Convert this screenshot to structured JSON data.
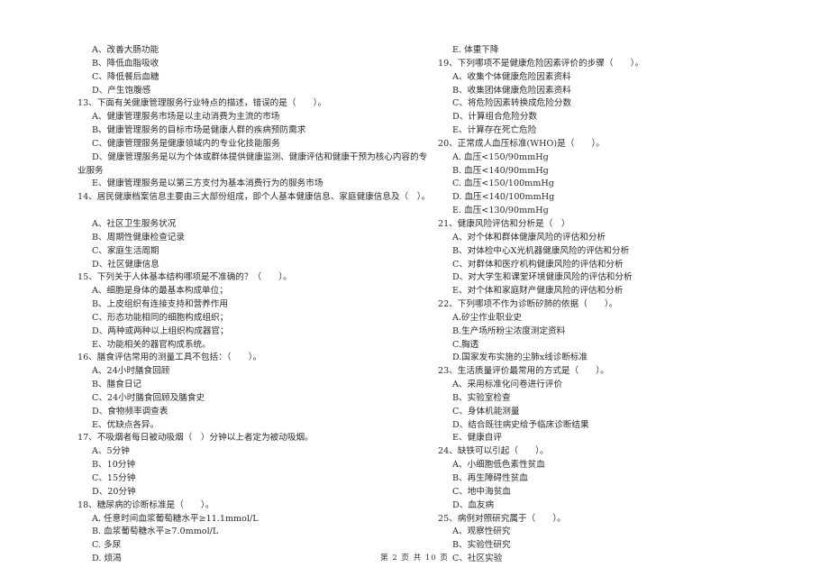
{
  "left_column": [
    {
      "type": "opt",
      "text": "A、改善大肠功能"
    },
    {
      "type": "opt",
      "text": "B、降低血脂吸收"
    },
    {
      "type": "opt",
      "text": "C、降低餐后血糖"
    },
    {
      "type": "opt",
      "text": "D、产生饱腹感"
    },
    {
      "type": "q",
      "text": "13、下面有关健康管理服务行业特点的描述，错误的是（　　）。"
    },
    {
      "type": "opt",
      "text": "A、健康管理服务市场是以主动消费为主流的市场"
    },
    {
      "type": "opt",
      "text": "B、健康管理服务的目标市场是健康人群的疾病预防需求"
    },
    {
      "type": "opt",
      "text": "C、健康管理服务是健康领域内的专业化技能服务"
    },
    {
      "type": "opt",
      "text": "D、健康管理服务是以为个体或群体提供健康监测、健康评估和健康干预为核心内容的专"
    },
    {
      "type": "cont",
      "text": "业服务"
    },
    {
      "type": "opt",
      "text": "E、健康管理服务是以第三方支付为基本消费行为的服务市场"
    },
    {
      "type": "q",
      "text": "14、居民健康档案信息主要由三大部份组成，即个人基本健康信息、家庭健康信息及（　）。"
    },
    {
      "type": "blank",
      "text": ""
    },
    {
      "type": "opt",
      "text": "A、社区卫生服务状况"
    },
    {
      "type": "opt",
      "text": "B、周期性健康检查记录"
    },
    {
      "type": "opt",
      "text": "C、家庭生活周期"
    },
    {
      "type": "opt",
      "text": "D、社区健康信息"
    },
    {
      "type": "q",
      "text": "15、下列关于人体基本结构哪项是不准确的？（　　）。"
    },
    {
      "type": "opt",
      "text": "A、细胞是身体的最基本构成单位；"
    },
    {
      "type": "opt",
      "text": "B、上皮组织有连接支持和营养作用"
    },
    {
      "type": "opt",
      "text": "C、形态功能相同的细胞构成组织；"
    },
    {
      "type": "opt",
      "text": "D、两种或两种以上组织构成器官；"
    },
    {
      "type": "opt",
      "text": "E、功能相关的器官构成系统。"
    },
    {
      "type": "q",
      "text": "16、膳食评估常用的测量工具不包括：（　　）。"
    },
    {
      "type": "opt",
      "text": "A、24小时膳食回顾"
    },
    {
      "type": "opt",
      "text": "B、膳食日记"
    },
    {
      "type": "opt",
      "text": "C、24小时膳食回顾及膳食史"
    },
    {
      "type": "opt",
      "text": "D、食物频率调查表"
    },
    {
      "type": "opt",
      "text": "E、优缺点各异。"
    },
    {
      "type": "q",
      "text": "17、不吸烟者每日被动吸烟（　）分钟以上者定为被动吸烟。"
    },
    {
      "type": "opt",
      "text": "A、5分钟"
    },
    {
      "type": "opt",
      "text": "B、10分钟"
    },
    {
      "type": "opt",
      "text": "C、15分钟"
    },
    {
      "type": "opt",
      "text": "D、20分钟"
    },
    {
      "type": "q",
      "text": "18、糖尿病的诊断标准是（　　）。"
    },
    {
      "type": "opt",
      "text": "A. 任意时间血浆葡萄糖水平≥11.1mmol/L"
    },
    {
      "type": "opt",
      "text": "B. 血浆葡萄糖水平≥7.0mmol/L"
    },
    {
      "type": "opt",
      "text": "C. 多尿"
    },
    {
      "type": "opt",
      "text": "D. 烦渴"
    }
  ],
  "right_column": [
    {
      "type": "opt",
      "text": "E. 体重下降"
    },
    {
      "type": "q",
      "text": "19、下列哪项不是健康危险因素评价的步骤（　　）。"
    },
    {
      "type": "opt",
      "text": "A、收集个体健康危险因素资料"
    },
    {
      "type": "opt",
      "text": "B、收集团体健康危险因素资料"
    },
    {
      "type": "opt",
      "text": "C、将危险因素转换成危险分数"
    },
    {
      "type": "opt",
      "text": "D、计算组合危险分数"
    },
    {
      "type": "opt",
      "text": "E、计算存在死亡危险"
    },
    {
      "type": "q",
      "text": "20、正常成人血压标准(WHO)是（　　）。"
    },
    {
      "type": "opt",
      "text": "A. 血压<150/90mmHg"
    },
    {
      "type": "opt",
      "text": "B. 血压<140/90mmHg"
    },
    {
      "type": "opt",
      "text": "C. 血压<150/100mmHg"
    },
    {
      "type": "opt",
      "text": "D. 血压<140/100mmHg"
    },
    {
      "type": "opt",
      "text": "E. 血压<130/90mmHg"
    },
    {
      "type": "q",
      "text": "21、健康风险评估和分析是（　）"
    },
    {
      "type": "opt",
      "text": "A、对个体和群体健康风险的评估和分析"
    },
    {
      "type": "opt",
      "text": "B、对体检中心X光机器健康风险的评估和分析"
    },
    {
      "type": "opt",
      "text": "C、对群体和医疗机构健康风险的评估和分析"
    },
    {
      "type": "opt",
      "text": "D、对大学生和课堂环境健康风险的评估和分析"
    },
    {
      "type": "opt",
      "text": "E、对个体和家庭财产健康风险的评估和分析"
    },
    {
      "type": "q",
      "text": "22、下列哪项不作为诊断矽肺的依据（　　）。"
    },
    {
      "type": "opt",
      "text": "A.矽尘作业职业史"
    },
    {
      "type": "opt",
      "text": "B.生产场所粉尘浓度测定资料"
    },
    {
      "type": "opt",
      "text": "C.胸透"
    },
    {
      "type": "opt",
      "text": "D.国家发布实施的尘肺x线诊断标准"
    },
    {
      "type": "q",
      "text": "23、生活质量评价最常用的方式是（　　）。"
    },
    {
      "type": "opt",
      "text": "A、采用标准化问卷进行评价"
    },
    {
      "type": "opt",
      "text": "B、实验室检查"
    },
    {
      "type": "opt",
      "text": "C、身体机能测量"
    },
    {
      "type": "opt",
      "text": "D、结合既往病史给予临床诊断结果"
    },
    {
      "type": "opt",
      "text": "E、健康自评"
    },
    {
      "type": "q",
      "text": "24、缺铁可以引起（　　）。"
    },
    {
      "type": "opt",
      "text": "A、小细胞低色素性贫血"
    },
    {
      "type": "opt",
      "text": "B、再生障碍性贫血"
    },
    {
      "type": "opt",
      "text": "C、地中海贫血"
    },
    {
      "type": "opt",
      "text": "D、血友病"
    },
    {
      "type": "q",
      "text": "25、病例对照研究属于（　　）。"
    },
    {
      "type": "opt",
      "text": "A、观察性研究"
    },
    {
      "type": "opt",
      "text": "B、实验性研究"
    },
    {
      "type": "opt",
      "text": "C、社区实验"
    }
  ],
  "footer": {
    "page_label": "第 2 页 共 10 页"
  }
}
